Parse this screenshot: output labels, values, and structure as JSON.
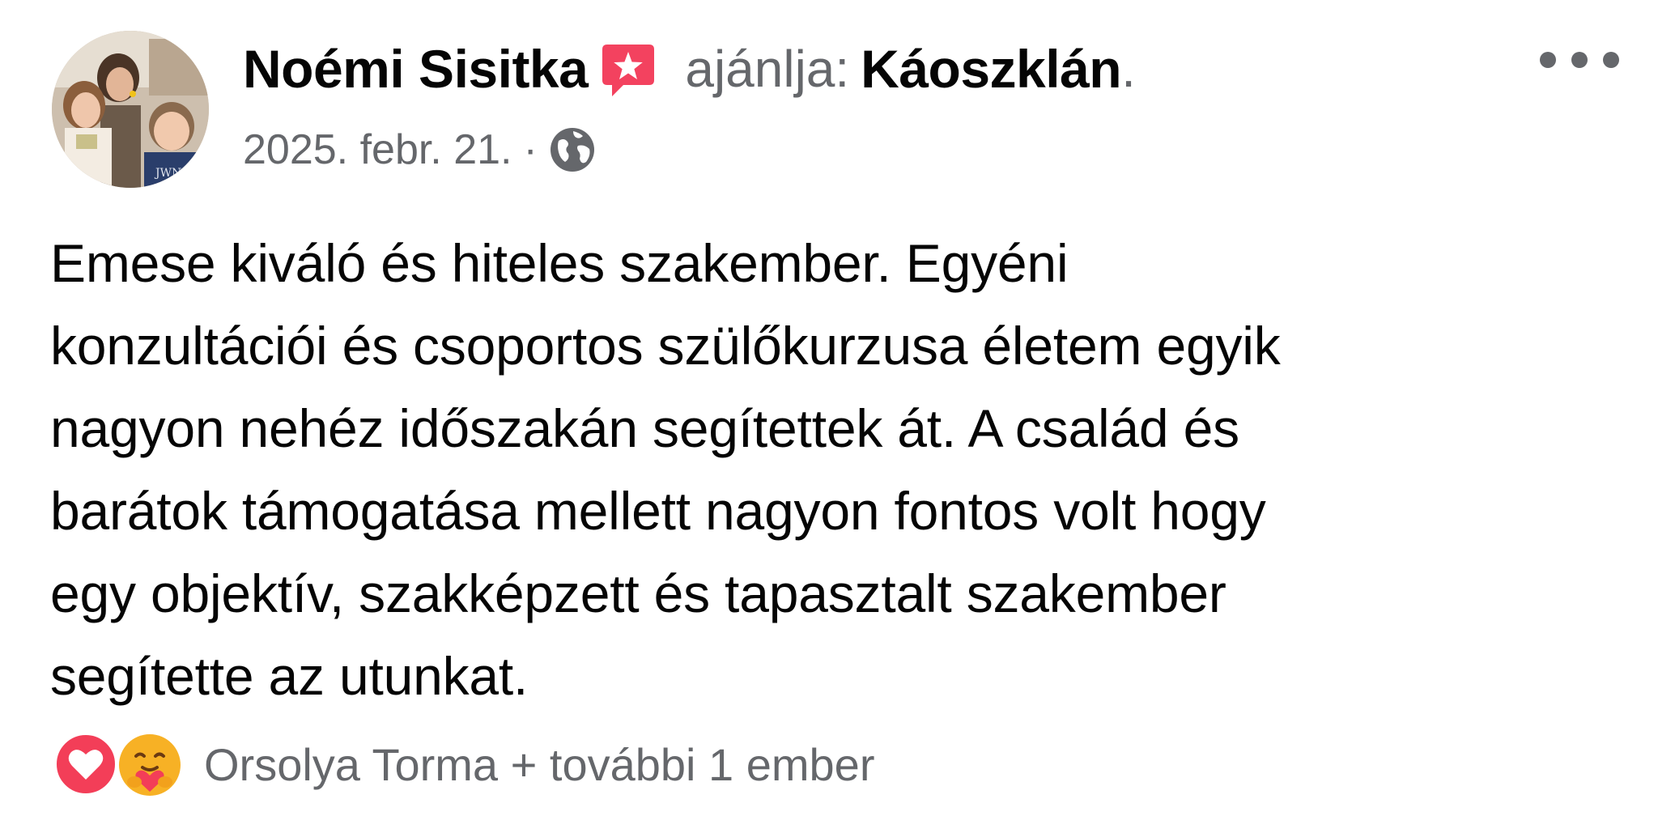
{
  "post": {
    "author": "Noémi Sisitka",
    "recommends_label": "ajánlja:",
    "page": "Káoszklán",
    "page_suffix": ".",
    "date": "2025. febr. 21.",
    "separator": "·",
    "audience_icon": "globe-icon",
    "menu_icon": "more-options-icon",
    "body": "Emese kiváló és hiteles szakember. Egyéni\nkonzultációi és csoportos szülőkurzusa életem egyik\nnagyon nehéz időszakán segítettek át.  A család  és\nbarátok támogatása mellett nagyon fontos volt hogy\negy objektív, szakképzett és tapasztalt szakember\nsegítette az utunkat.",
    "reactions": {
      "icons": [
        "love-reaction-icon",
        "care-reaction-icon"
      ],
      "text": "Orsolya Torma + további 1 ember"
    }
  },
  "colors": {
    "text_primary": "#050505",
    "text_secondary": "#65676b",
    "recommend_badge": "#f3425f",
    "love_reaction": "#f33e58",
    "care_reaction": "#f7b125"
  }
}
